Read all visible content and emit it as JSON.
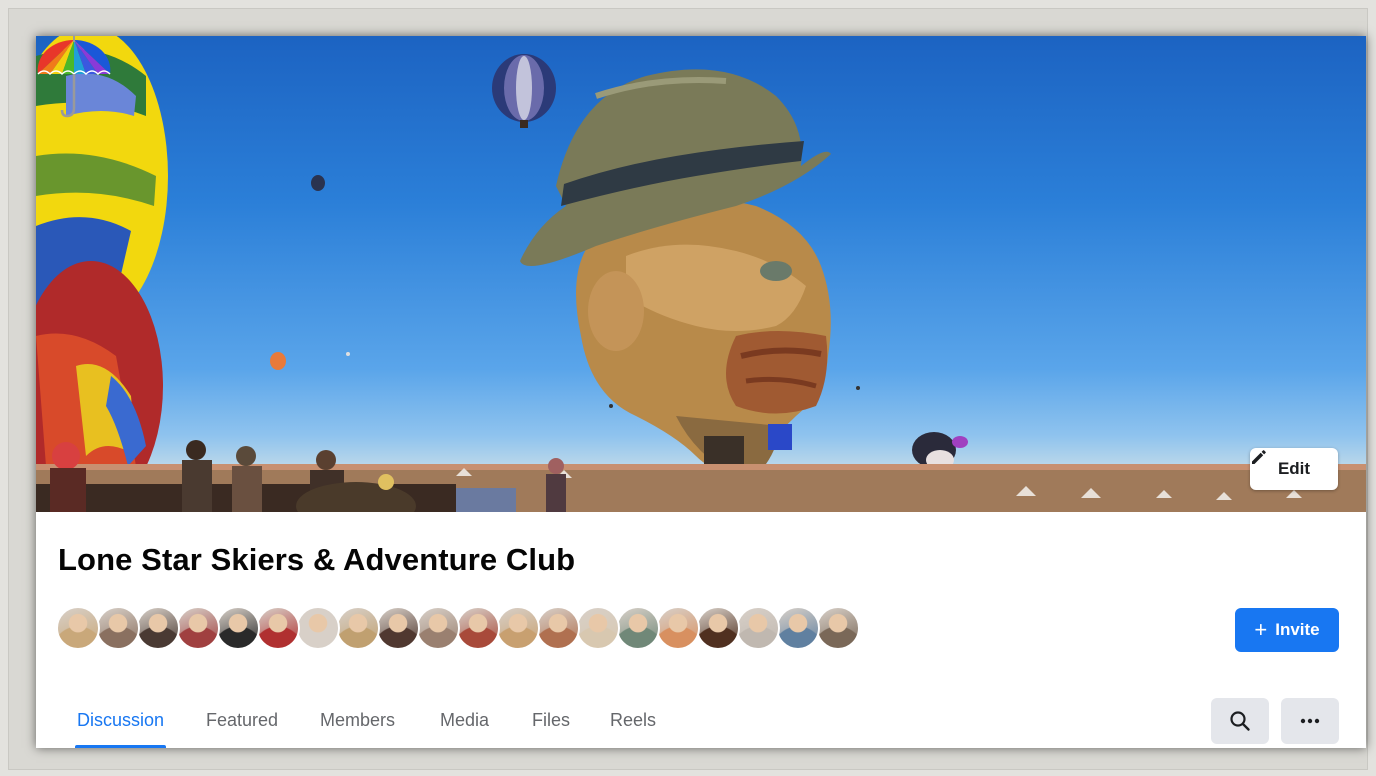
{
  "group": {
    "name": "Lone Star Skiers & Adventure Club"
  },
  "cover": {
    "edit_label": "Edit",
    "edit_icon": "pencil-icon",
    "overlay_icon": "umbrella-icon"
  },
  "members": {
    "avatar_count": 20,
    "avatar_colors": [
      "#c9a87a",
      "#8a7060",
      "#4a3a33",
      "#a04040",
      "#2a2a2a",
      "#b03030",
      "#d8d0c8",
      "#c0a070",
      "#503830",
      "#9a8070",
      "#a84a3a",
      "#c8a070",
      "#b07050",
      "#d8c8b0",
      "#708878",
      "#d89060",
      "#503020",
      "#c0b8b0",
      "#6080a0",
      "#7a6858"
    ]
  },
  "actions": {
    "invite_label": "Invite",
    "invite_icon": "plus-icon"
  },
  "tabs": [
    {
      "label": "Discussion",
      "active": true
    },
    {
      "label": "Featured",
      "active": false
    },
    {
      "label": "Members",
      "active": false
    },
    {
      "label": "Media",
      "active": false
    },
    {
      "label": "Files",
      "active": false
    },
    {
      "label": "Reels",
      "active": false
    }
  ],
  "toolbar": {
    "search_icon": "search-icon",
    "more_icon": "more-icon"
  },
  "colors": {
    "accent": "#1877f2",
    "title": "#050505",
    "muted": "#65676b"
  }
}
